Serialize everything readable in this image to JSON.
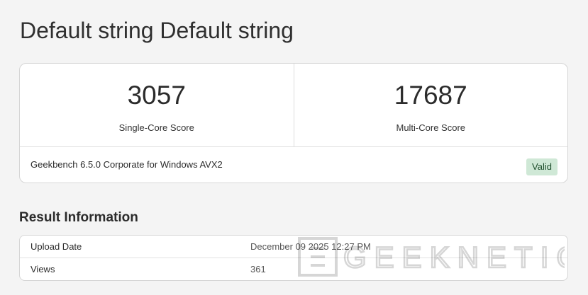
{
  "page": {
    "title": "Default string Default string"
  },
  "scores": {
    "single_core": {
      "value": "3057",
      "label": "Single-Core Score"
    },
    "multi_core": {
      "value": "17687",
      "label": "Multi-Core Score"
    }
  },
  "benchmark": {
    "version": "Geekbench 6.5.0 Corporate for Windows AVX2",
    "status": "Valid"
  },
  "result_information": {
    "title": "Result Information",
    "rows": [
      {
        "key": "Upload Date",
        "value": "December 09 2025 12:27 PM"
      },
      {
        "key": "Views",
        "value": "361"
      }
    ]
  },
  "watermark": {
    "text": "GEEKNETIC"
  },
  "colors": {
    "page_background": "#f4f4f4",
    "card_background": "#ffffff",
    "valid_badge": "#cfe8d6",
    "border": "#d6d6d6"
  }
}
